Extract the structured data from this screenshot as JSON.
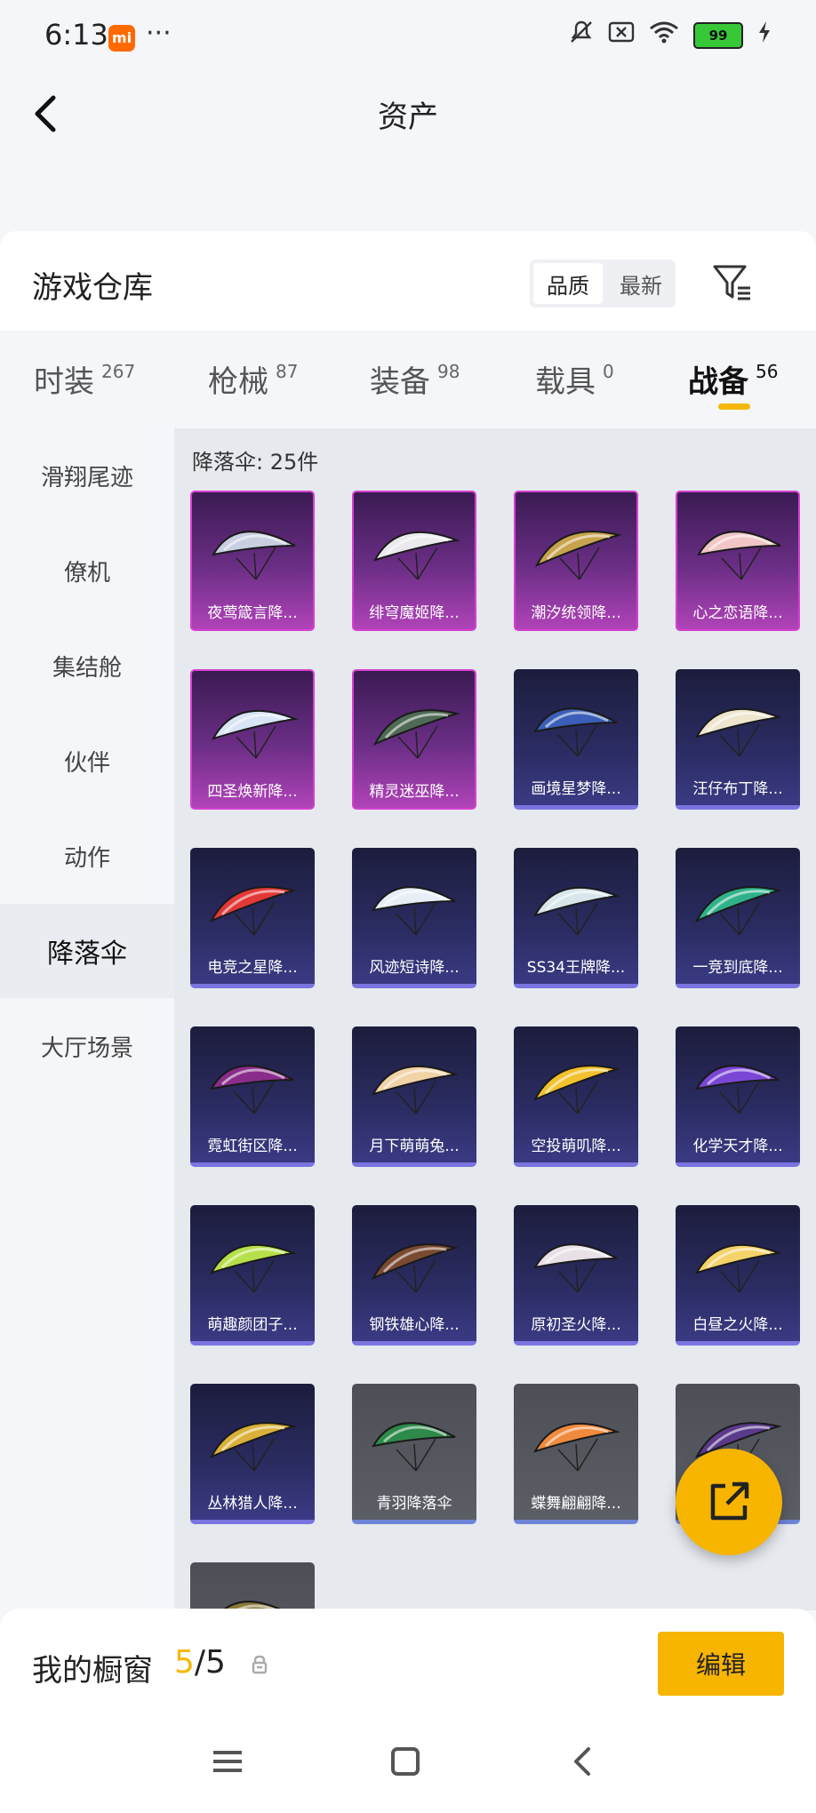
{
  "status_bar": {
    "time": "6:13",
    "mi_badge": "mi",
    "dots": "···",
    "battery": "99"
  },
  "header": {
    "title": "资产"
  },
  "warehouse": {
    "title": "游戏仓库",
    "sort_options": [
      "品质",
      "最新"
    ],
    "active_sort": "品质"
  },
  "tabs": [
    {
      "label": "时装",
      "count": "267"
    },
    {
      "label": "枪械",
      "count": "87"
    },
    {
      "label": "装备",
      "count": "98"
    },
    {
      "label": "载具",
      "count": "0"
    },
    {
      "label": "战备",
      "count": "56"
    }
  ],
  "active_tab": "战备",
  "sidebar": {
    "items": [
      "滑翔尾迹",
      "僚机",
      "集结舱",
      "伙伴",
      "动作",
      "降落伞",
      "大厅场景"
    ],
    "active": "降落伞"
  },
  "content": {
    "count_label": "降落伞: 25件"
  },
  "items": [
    {
      "name": "夜莺箴言降...",
      "rarity": "purple",
      "color": "#c9cfe0"
    },
    {
      "name": "绯穹魔姬降...",
      "rarity": "purple",
      "color": "#e9e9ee"
    },
    {
      "name": "潮汐统领降...",
      "rarity": "purple",
      "color": "#c8a34e"
    },
    {
      "name": "心之恋语降...",
      "rarity": "purple",
      "color": "#f2c6c6"
    },
    {
      "name": "四圣焕新降...",
      "rarity": "purple",
      "color": "#d9e5f5"
    },
    {
      "name": "精灵迷巫降...",
      "rarity": "purple",
      "color": "#4f6a55"
    },
    {
      "name": "画境星梦降...",
      "rarity": "blue",
      "color": "#3b5fb8"
    },
    {
      "name": "汪仔布丁降...",
      "rarity": "blue",
      "color": "#efe6d0"
    },
    {
      "name": "电竞之星降...",
      "rarity": "blue",
      "color": "#e33838"
    },
    {
      "name": "风迹短诗降...",
      "rarity": "blue",
      "color": "#e8eef5"
    },
    {
      "name": "SS34王牌降...",
      "rarity": "blue",
      "color": "#d7e6ea"
    },
    {
      "name": "一竞到底降...",
      "rarity": "blue",
      "color": "#2fb28a"
    },
    {
      "name": "霓虹街区降...",
      "rarity": "blue",
      "color": "#8a2c8a"
    },
    {
      "name": "月下萌萌兔...",
      "rarity": "blue",
      "color": "#f1d3a8"
    },
    {
      "name": "空投萌叽降...",
      "rarity": "blue",
      "color": "#f2c12e"
    },
    {
      "name": "化学天才降...",
      "rarity": "blue",
      "color": "#7a46d6"
    },
    {
      "name": "萌趣颜团子...",
      "rarity": "blue",
      "color": "#b6e04a"
    },
    {
      "name": "钢铁雄心降...",
      "rarity": "blue",
      "color": "#7a4a32"
    },
    {
      "name": "原初圣火降...",
      "rarity": "blue",
      "color": "#e8e0e6"
    },
    {
      "name": "白昼之火降...",
      "rarity": "blue",
      "color": "#f3d36a"
    },
    {
      "name": "丛林猎人降...",
      "rarity": "blue",
      "color": "#d9b13a"
    },
    {
      "name": "青羽降落伞",
      "rarity": "gray",
      "color": "#2e8a4a"
    },
    {
      "name": "蝶舞翩翩降...",
      "rarity": "gray",
      "color": "#f08a3c"
    },
    {
      "name": "",
      "rarity": "gray",
      "color": "#5b3a8c"
    },
    {
      "name": "",
      "rarity": "gray",
      "color": "#8a7a3a"
    }
  ],
  "showcase": {
    "title": "我的橱窗",
    "current": "5",
    "separator": "/",
    "total": "5",
    "edit_label": "编辑"
  },
  "icons": {
    "back": "chevron-left-icon",
    "filter": "filter-icon",
    "share": "share-external-icon",
    "lock": "lock-icon",
    "nav_menu": "menu-icon",
    "nav_home": "home-square-icon",
    "nav_back": "back-chevron-icon"
  },
  "colors": {
    "accent": "#f5b80a",
    "button": "#f7b500",
    "purple_rarity": "#d63fd0",
    "blue_rarity": "#7a74e0"
  }
}
